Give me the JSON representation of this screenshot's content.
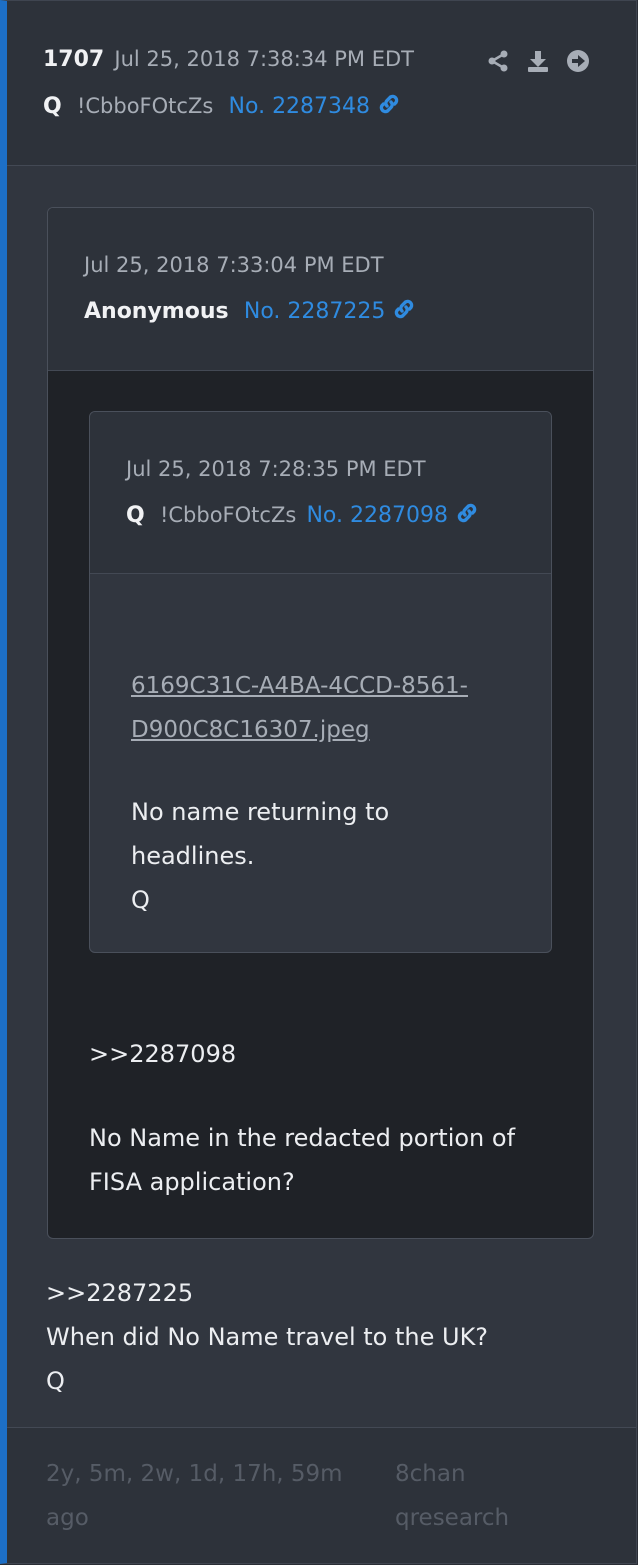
{
  "post": {
    "number": "1707",
    "date": "Jul 25, 2018 7:38:34 PM EDT",
    "author": "Q",
    "trip": "!CbboFOtcZs",
    "post_no": "No. 2287348",
    "actions": [
      "share-icon",
      "download-icon",
      "arrow-right-circle-icon"
    ],
    "body_lines": [
      ">>2287225",
      "When did No Name travel to the UK?",
      "Q"
    ]
  },
  "quote1": {
    "date": "Jul 25, 2018 7:33:04 PM EDT",
    "author": "Anonymous",
    "post_no": "No. 2287225",
    "body_lines": [
      ">>2287098",
      "No Name in the redacted portion of",
      "FISA application?"
    ]
  },
  "quote2": {
    "date": "Jul 25, 2018 7:28:35 PM EDT",
    "author": "Q",
    "trip": "!CbboFOtcZs",
    "post_no": "No. 2287098",
    "file_lines": [
      "6169C31C-A4BA-4CCD-8561-",
      "D900C8C16307.jpeg"
    ],
    "body_lines": [
      "No name returning to",
      "headlines.",
      "Q"
    ]
  },
  "footer": {
    "age_lines": [
      "2y, 5m, 2w, 1d, 17h, 59m",
      "ago"
    ],
    "source_lines": [
      "8chan",
      "qresearch"
    ]
  },
  "colors": {
    "accent": "#1d6fc6",
    "link": "#2f8be0",
    "background": "#31363f"
  }
}
